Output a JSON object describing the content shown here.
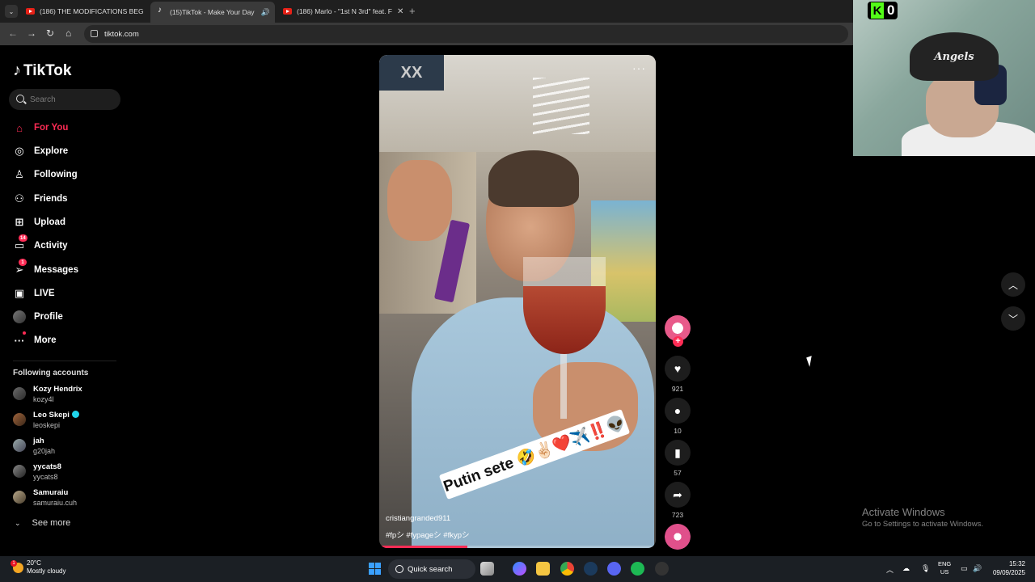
{
  "browser": {
    "tabs": [
      {
        "title": "(186) THE MODIFICATIONS BEG",
        "icon": "youtube-icon",
        "active": false
      },
      {
        "title": "(15)TikTok - Make Your Day",
        "icon": "tiktok-icon",
        "active": true
      },
      {
        "title": "(186) Marlo - \"1st N 3rd\" feat. F",
        "icon": "youtube-icon",
        "active": false
      }
    ],
    "url": "tiktok.com"
  },
  "sidebar": {
    "logo": "TikTok",
    "search_placeholder": "Search",
    "nav": [
      {
        "label": "For You",
        "icon": "home-icon",
        "active": true
      },
      {
        "label": "Explore",
        "icon": "compass-icon"
      },
      {
        "label": "Following",
        "icon": "following-icon"
      },
      {
        "label": "Friends",
        "icon": "friends-icon"
      },
      {
        "label": "Upload",
        "icon": "upload-icon"
      },
      {
        "label": "Activity",
        "icon": "activity-icon",
        "badge": "14"
      },
      {
        "label": "Messages",
        "icon": "messages-icon",
        "badge": "1"
      },
      {
        "label": "LIVE",
        "icon": "live-icon"
      },
      {
        "label": "Profile",
        "icon": "profile-avatar"
      },
      {
        "label": "More",
        "icon": "more-icon"
      }
    ],
    "following_title": "Following accounts",
    "accounts": [
      {
        "name": "Kozy Hendrix",
        "handle": "kozy4l",
        "verified": false
      },
      {
        "name": "Leo Skepi",
        "handle": "leoskepi",
        "verified": true
      },
      {
        "name": "jah",
        "handle": "g20jah",
        "verified": false
      },
      {
        "name": "yycats8",
        "handle": "yycats8",
        "verified": false
      },
      {
        "name": "Samuraiu",
        "handle": "samuraiu.cuh",
        "verified": false
      }
    ],
    "see_more": "See more"
  },
  "video": {
    "caption_overlay": "Putin sete 🤣✌🏻❤️✈️‼️👽",
    "author": "cristiangranded911",
    "tags": "#fpシ  #fypageシ  #fkypシ",
    "menu": "···",
    "watermark": "XX",
    "progress": 0.32
  },
  "actions": {
    "likes": "921",
    "comments": "10",
    "saves": "57",
    "shares": "723",
    "follow": "+"
  },
  "webcam": {
    "cap_text": "Angels",
    "kick_count": "0"
  },
  "activate_windows": {
    "title": "Activate Windows",
    "subtitle": "Go to Settings to activate Windows."
  },
  "taskbar": {
    "weather_temp": "20°C",
    "weather_cond": "Mostly cloudy",
    "weather_badge": "1",
    "search": "Quick search",
    "lang_top": "ENG",
    "lang_bottom": "US",
    "time": "15:32",
    "date": "09/09/2025"
  },
  "colors": {
    "accent": "#fe2c55",
    "kick_green": "#53fc18"
  }
}
